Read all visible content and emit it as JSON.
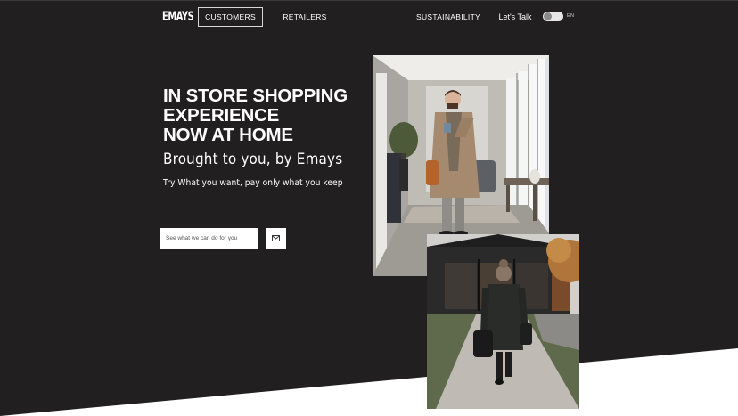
{
  "header": {
    "logo": "EMAYS",
    "nav": {
      "customers": "CUSTOMERS",
      "retailers": "RETAILERS",
      "sustainability": "SUSTAINABILITY",
      "lets_talk": "Let's Talk",
      "language": "EN"
    }
  },
  "hero": {
    "title_lines": [
      "IN STORE SHOPPING",
      "EXPERIENCE",
      "NOW AT HOME"
    ],
    "subtitle": "Brought to you, by Emays",
    "tagline": "Try What you want, pay only what you keep",
    "cta": {
      "placeholder": "See what we can do for you",
      "submit_icon": "mail-icon"
    }
  },
  "images": {
    "photo_1": "man-in-coat-using-phone-photo",
    "photo_2": "woman-walking-with-shopping-bags-photo"
  },
  "colors": {
    "background": "#221f20",
    "accent_text": "#ffffff",
    "slant": "#ffffff"
  }
}
